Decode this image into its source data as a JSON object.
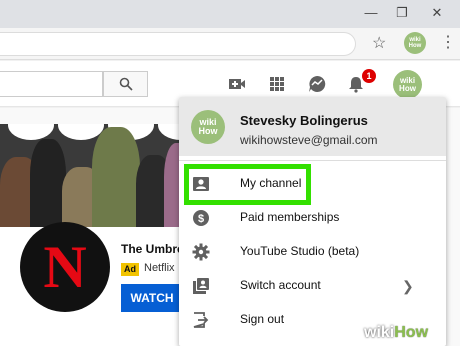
{
  "colors": {
    "highlight": "#33e000",
    "watch_button": "#065fd4",
    "badge": "#dd0000",
    "netflix_red": "#e50914",
    "ad_badge": "#f2c300"
  },
  "browser": {
    "window_controls": [
      "minimize-icon",
      "restore-icon",
      "close-icon"
    ],
    "bookmark_icon": "star-icon",
    "profile_label_top": "wiki",
    "profile_label_bottom": "How",
    "menu_icon": "kebab-menu-icon"
  },
  "youtube_header": {
    "search_icon": "search-icon",
    "icons": [
      "create-video-icon",
      "apps-grid-icon",
      "messages-icon",
      "notifications-bell-icon"
    ],
    "notification_count": "1",
    "avatar_top": "wiki",
    "avatar_bottom": "How"
  },
  "channel": {
    "logo_letter": "N",
    "title": "The Umbre",
    "ad_label": "Ad",
    "brand": "Netflix",
    "watch_label": "WATCH"
  },
  "account_menu": {
    "avatar_top": "wiki",
    "avatar_bottom": "How",
    "name": "Stevesky Bolingerus",
    "email": "wikihowsteve@gmail.com",
    "items": [
      {
        "label": "My channel",
        "icon": "person-box-icon"
      },
      {
        "label": "Paid memberships",
        "icon": "dollar-circle-icon"
      },
      {
        "label": "YouTube Studio (beta)",
        "icon": "gear-icon"
      },
      {
        "label": "Switch account",
        "icon": "switch-account-icon"
      },
      {
        "label": "Sign out",
        "icon": "sign-out-icon"
      }
    ]
  },
  "watermark": {
    "wiki": "wiki",
    "how": "How"
  }
}
